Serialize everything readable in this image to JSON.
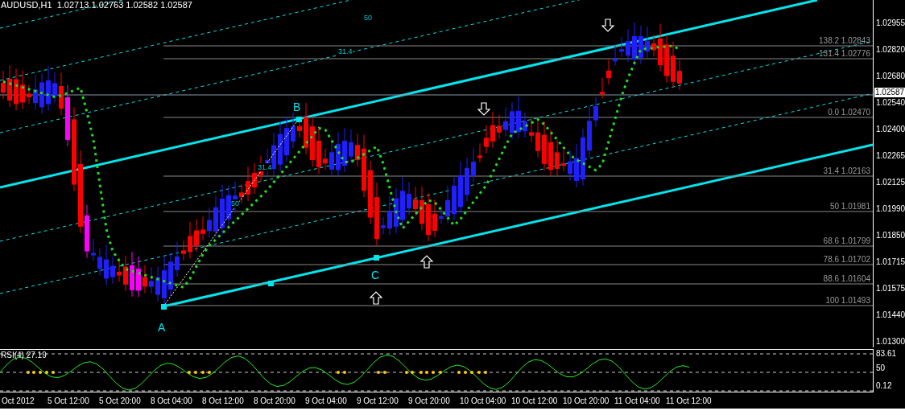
{
  "chart_title": "AUDUSD,H1  1.02713 1.02763 1.02582 1.02587",
  "price_axis": [
    "1.02955",
    "1.02820",
    "1.02680",
    "1.02540",
    "1.02400",
    "1.02265",
    "1.02125",
    "1.01990",
    "1.01850",
    "1.01715",
    "1.01575",
    "1.01440",
    "1.01300"
  ],
  "current_price": "1.02587",
  "fib_levels": [
    {
      "label": "138.2 1.02843"
    },
    {
      "label": "131.4 1.02776"
    },
    {
      "label": "0.0 1.02470"
    },
    {
      "label": "31.4 1.02163"
    },
    {
      "label": "50 1.01981"
    },
    {
      "label": "68.6 1.01799"
    },
    {
      "label": "78.6 1.01702"
    },
    {
      "label": "88.6 1.01604"
    },
    {
      "label": "100 1.01493"
    }
  ],
  "points": [
    "A",
    "B",
    "C"
  ],
  "fan_labels": [
    "50",
    "31.4",
    "31.4",
    "50"
  ],
  "rsi": {
    "title": "RSI(4) 27.19",
    "axis": [
      "83.61",
      "50",
      "0.12"
    ]
  },
  "time_axis": [
    "Oct 2012",
    "5 Oct 12:00",
    "5 Oct 20:00",
    "8 Oct 04:00",
    "8 Oct 12:00",
    "8 Oct 20:00",
    "9 Oct 04:00",
    "9 Oct 12:00",
    "9 Oct 20:00",
    "10 Oct 04:00",
    "10 Oct 12:00",
    "10 Oct 20:00",
    "11 Oct 04:00",
    "11 Oct 12:00"
  ]
}
